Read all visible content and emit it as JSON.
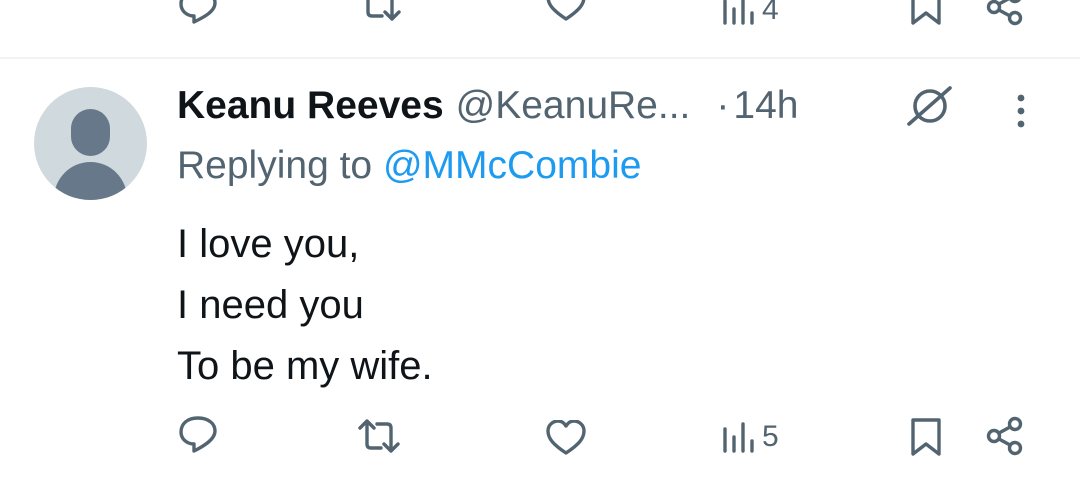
{
  "previous_tweet": {
    "views_count": "4"
  },
  "tweet": {
    "author_name": "Keanu Reeves",
    "author_handle": "@KeanuRe...",
    "separator": "·",
    "time": "14h",
    "replying_prefix": "Replying to",
    "replying_to": "@MMcCombie",
    "text_lines": [
      "I love you,",
      "I need you",
      "To be my wife."
    ],
    "views_count": "5"
  },
  "colors": {
    "text_primary": "#0f1419",
    "text_secondary": "#536471",
    "accent": "#1d9bf0",
    "avatar_bg": "#cfd9de",
    "avatar_fg": "#67788a",
    "divider": "#eff3f4"
  },
  "icons": [
    "reply-icon",
    "retweet-icon",
    "like-icon",
    "views-icon",
    "bookmark-icon",
    "share-icon",
    "grok-icon",
    "more-icon"
  ]
}
